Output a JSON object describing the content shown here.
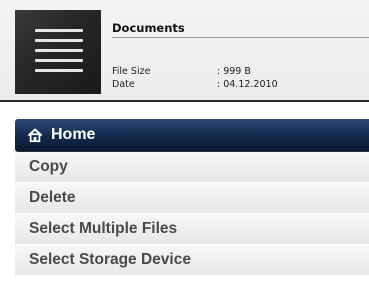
{
  "file_info": {
    "title": "Documents",
    "file_size_label": "File Size",
    "file_size_value": ": 999 B",
    "date_label": "Date",
    "date_value": ": 04.12.2010",
    "thumbnail_icon": "document-lines-icon"
  },
  "menu": {
    "items": [
      {
        "label": "Home",
        "icon": "home-icon",
        "active": true
      },
      {
        "label": "Copy"
      },
      {
        "label": "Delete"
      },
      {
        "label": "Select Multiple Files"
      },
      {
        "label": "Select Storage Device"
      }
    ]
  },
  "colors": {
    "active_item_bg": "#13284a",
    "inactive_item_text": "#4a4a4a",
    "panel_divider": "#2a2a2a"
  }
}
